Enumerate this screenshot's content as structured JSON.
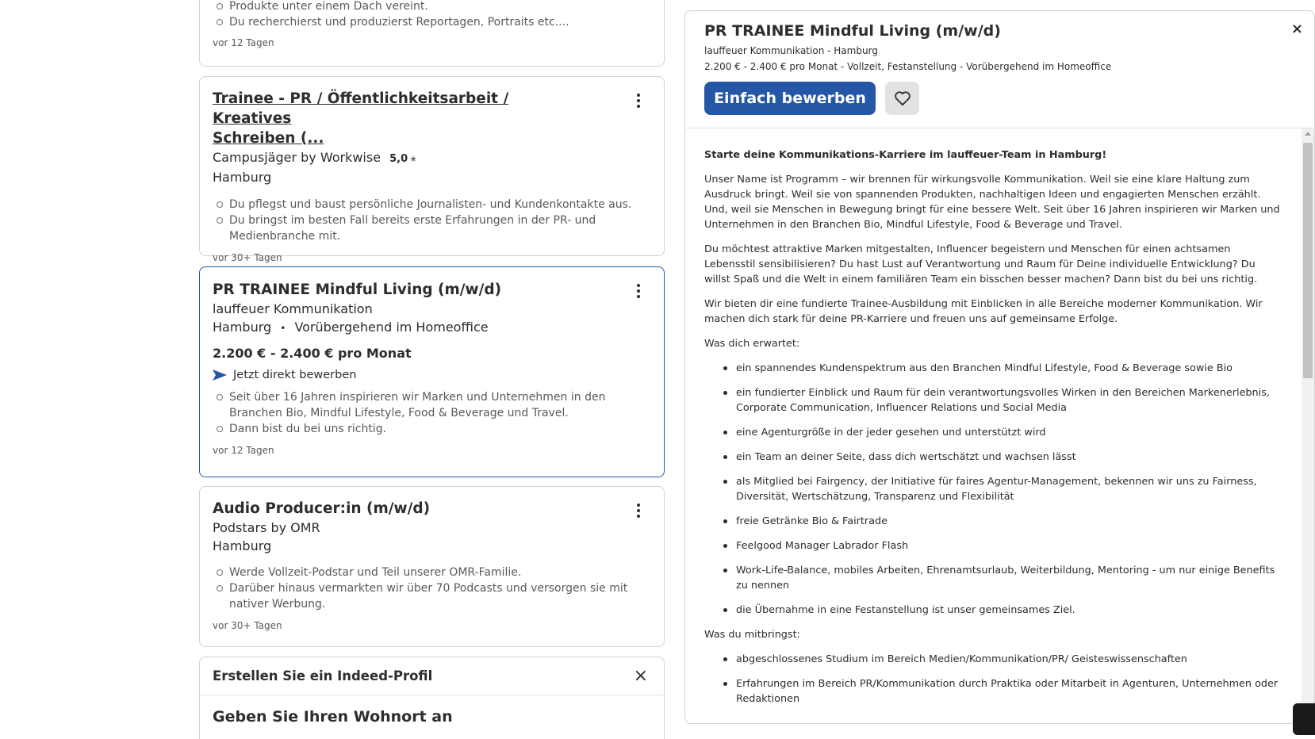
{
  "cards": [
    {
      "bullets": [
        "Produkte unter einem Dach vereint.",
        "Du recherchierst und produzierst Reportagen, Portraits etc...."
      ],
      "date": "vor 12 Tagen"
    },
    {
      "title_line1": "Trainee - PR / Öffentlichkeitsarbeit / Kreatives",
      "title_line2": "Schreiben (...",
      "company": "Campusjäger by Workwise",
      "rating": "5,0",
      "star": "★",
      "location": "Hamburg",
      "bullets": [
        "Du pflegst und baust persönliche Journalisten- und Kundenkontakte aus.",
        "Du bringst im besten Fall bereits erste Erfahrungen in der PR- und Medienbranche mit."
      ],
      "date": "vor 30+ Tagen"
    },
    {
      "title": "PR TRAINEE Mindful Living (m/w/d)",
      "company": "lauffeuer Kommunikation",
      "location": "Hamburg",
      "separator": "•",
      "remote": "Vorübergehend im Homeoffice",
      "salary": "2.200 € - 2.400 € pro Monat",
      "apply_direct": "Jetzt direkt bewerben",
      "bullets": [
        "Seit über 16 Jahren inspirieren wir Marken und Unternehmen in den Branchen Bio, Mindful Lifestyle, Food & Beverage und Travel.",
        "Dann bist du bei uns richtig."
      ],
      "date": "vor 12 Tagen"
    },
    {
      "title": "Audio Producer:in (m/w/d)",
      "company": "Podstars by OMR",
      "location": "Hamburg",
      "bullets": [
        "Werde Vollzeit-Podstar und Teil unserer OMR-Familie.",
        "Darüber hinaus vermarkten wir über 70 Podcasts und versorgen sie mit nativer Werbung."
      ],
      "date": "vor 30+ Tagen"
    }
  ],
  "profile_card": {
    "title": "Erstellen Sie ein Indeed-Profil",
    "close": "×",
    "subtitle": "Geben Sie Ihren Wohnort an"
  },
  "detail": {
    "title": "PR TRAINEE Mindful Living (m/w/d)",
    "company_line": "lauffeuer Kommunikation - Hamburg",
    "meta_line": "2.200 € - 2.400 € pro Monat - Vollzeit, Festanstellung - Vorübergehend im Homeoffice",
    "close": "×",
    "apply_label": "Einfach bewerben",
    "heading": "Starte deine Kommunikations-Karriere im lauffeuer-Team in Hamburg!",
    "paragraphs": [
      "Unser Name ist Programm – wir brennen für wirkungsvolle Kommunikation. Weil sie eine klare Haltung zum Ausdruck bringt. Weil sie von spannenden Produkten, nachhaltigen Ideen und engagierten Menschen erzählt. Und, weil sie Menschen in Bewegung bringt für eine bessere Welt. Seit über 16 Jahren inspirieren wir Marken und Unternehmen in den Branchen Bio, Mindful Lifestyle, Food & Beverage und Travel.",
      "Du möchtest attraktive Marken mitgestalten, Influencer begeistern und Menschen für einen achtsamen Lebensstil sensibilisieren? Du hast Lust auf Verantwortung und Raum für Deine individuelle Entwicklung? Du willst Spaß und die Welt in einem familiären Team ein bisschen besser machen? Dann bist du bei uns richtig.",
      "Wir bieten dir eine fundierte Trainee-Ausbildung mit Einblicken in alle Bereiche moderner Kommunikation. Wir machen dich stark für deine PR-Karriere und freuen uns auf gemeinsame Erfolge."
    ],
    "expect_label": "Was dich erwartet:",
    "expect_items": [
      "ein spannendes Kundenspektrum aus den Branchen Mindful Lifestyle, Food & Beverage sowie Bio",
      "ein fundierter Einblick und Raum für dein verantwortungsvolles Wirken in den Bereichen Markenerlebnis, Corporate Communication, Influencer Relations und Social Media",
      "eine Agenturgröße in der jeder gesehen und unterstützt wird",
      "ein Team an deiner Seite, dass dich wertschätzt und wachsen lässt",
      "als Mitglied bei Fairgency, der Initiative für faires Agentur-Management, bekennen wir uns zu Fairness, Diversität, Wertschätzung, Transparenz und Flexibilität",
      "freie Getränke Bio & Fairtrade",
      "Feelgood Manager Labrador Flash",
      "Work-Life-Balance, mobiles Arbeiten, Ehrenamtsurlaub, Weiterbildung, Mentoring - um nur einige Benefits zu nennen",
      "die Übernahme in eine Festanstellung ist unser gemeinsames Ziel."
    ],
    "bring_label": "Was du mitbringst:",
    "bring_items": [
      "abgeschlossenes Studium im Bereich Medien/Kommunikation/PR/ Geisteswissenschaften",
      "Erfahrungen im Bereich PR/Kommunikation durch Praktika oder Mitarbeit in Agenturen, Unternehmen oder Redaktionen"
    ]
  },
  "icons": {
    "kebab": "more-vertical-icon",
    "heart": "heart-icon",
    "arrow": "send-arrow-icon",
    "close": "close-icon",
    "star": "star-icon"
  },
  "colors": {
    "accent": "#2557a7",
    "border": "#d4d2d0"
  }
}
